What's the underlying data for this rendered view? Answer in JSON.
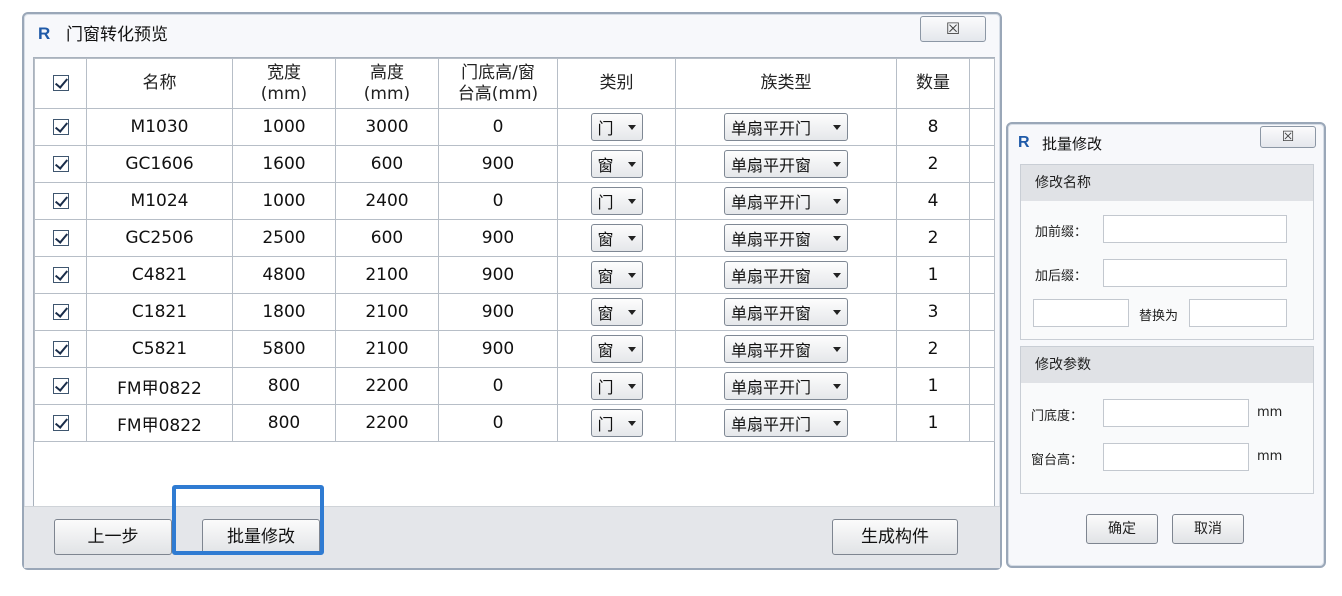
{
  "main_window": {
    "title": "门窗转化预览",
    "close_label": "☒",
    "columns": [
      "名称",
      "宽度\n(mm)",
      "高度\n(mm)",
      "门底高/窗\n台高(mm)",
      "类别",
      "族类型",
      "数量"
    ],
    "rows": [
      {
        "name": "M1030",
        "width": "1000",
        "height": "3000",
        "sill": "0",
        "category": "门",
        "family": "单扇平开门",
        "qty": "8"
      },
      {
        "name": "GC1606",
        "width": "1600",
        "height": "600",
        "sill": "900",
        "category": "窗",
        "family": "单扇平开窗",
        "qty": "2"
      },
      {
        "name": "M1024",
        "width": "1000",
        "height": "2400",
        "sill": "0",
        "category": "门",
        "family": "单扇平开门",
        "qty": "4"
      },
      {
        "name": "GC2506",
        "width": "2500",
        "height": "600",
        "sill": "900",
        "category": "窗",
        "family": "单扇平开窗",
        "qty": "2"
      },
      {
        "name": "C4821",
        "width": "4800",
        "height": "2100",
        "sill": "900",
        "category": "窗",
        "family": "单扇平开窗",
        "qty": "1"
      },
      {
        "name": "C1821",
        "width": "1800",
        "height": "2100",
        "sill": "900",
        "category": "窗",
        "family": "单扇平开窗",
        "qty": "3"
      },
      {
        "name": "C5821",
        "width": "5800",
        "height": "2100",
        "sill": "900",
        "category": "窗",
        "family": "单扇平开窗",
        "qty": "2"
      },
      {
        "name": "FM甲0822",
        "width": "800",
        "height": "2200",
        "sill": "0",
        "category": "门",
        "family": "单扇平开门",
        "qty": "1"
      },
      {
        "name": "FM甲0822",
        "width": "800",
        "height": "2200",
        "sill": "0",
        "category": "门",
        "family": "单扇平开门",
        "qty": "1"
      }
    ],
    "prev_label": "上一步",
    "batch_label": "批量修改",
    "generate_label": "生成构件"
  },
  "batch_dialog": {
    "title": "批量修改",
    "close_label": "☒",
    "rename_group": "修改名称",
    "prefix_label": "加前缀：",
    "suffix_label": "加后缀：",
    "replace_label": "替换为",
    "param_group": "修改参数",
    "door_sill_label": "门底度：",
    "window_sill_label": "窗台高：",
    "unit_mm": "mm",
    "ok_label": "确定",
    "cancel_label": "取消"
  },
  "colors": {
    "highlight": "#2f7bd2",
    "app_logo": "#1f5aa8"
  }
}
